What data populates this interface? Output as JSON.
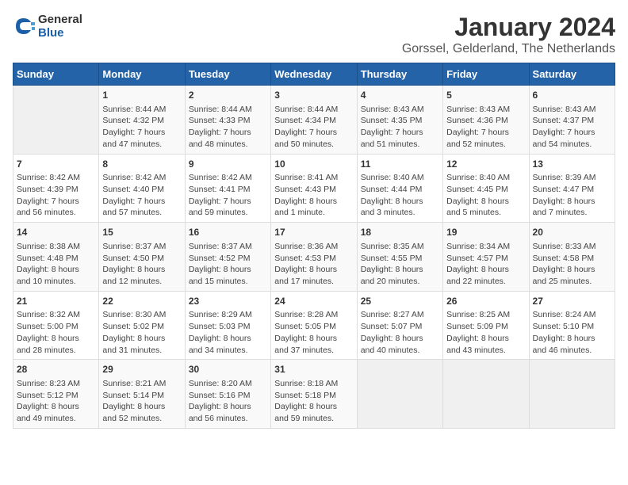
{
  "logo": {
    "text_general": "General",
    "text_blue": "Blue"
  },
  "title": "January 2024",
  "subtitle": "Gorssel, Gelderland, The Netherlands",
  "days_of_week": [
    "Sunday",
    "Monday",
    "Tuesday",
    "Wednesday",
    "Thursday",
    "Friday",
    "Saturday"
  ],
  "weeks": [
    [
      {
        "day": "",
        "content": ""
      },
      {
        "day": "1",
        "content": "Sunrise: 8:44 AM\nSunset: 4:32 PM\nDaylight: 7 hours\nand 47 minutes."
      },
      {
        "day": "2",
        "content": "Sunrise: 8:44 AM\nSunset: 4:33 PM\nDaylight: 7 hours\nand 48 minutes."
      },
      {
        "day": "3",
        "content": "Sunrise: 8:44 AM\nSunset: 4:34 PM\nDaylight: 7 hours\nand 50 minutes."
      },
      {
        "day": "4",
        "content": "Sunrise: 8:43 AM\nSunset: 4:35 PM\nDaylight: 7 hours\nand 51 minutes."
      },
      {
        "day": "5",
        "content": "Sunrise: 8:43 AM\nSunset: 4:36 PM\nDaylight: 7 hours\nand 52 minutes."
      },
      {
        "day": "6",
        "content": "Sunrise: 8:43 AM\nSunset: 4:37 PM\nDaylight: 7 hours\nand 54 minutes."
      }
    ],
    [
      {
        "day": "7",
        "content": "Sunrise: 8:42 AM\nSunset: 4:39 PM\nDaylight: 7 hours\nand 56 minutes."
      },
      {
        "day": "8",
        "content": "Sunrise: 8:42 AM\nSunset: 4:40 PM\nDaylight: 7 hours\nand 57 minutes."
      },
      {
        "day": "9",
        "content": "Sunrise: 8:42 AM\nSunset: 4:41 PM\nDaylight: 7 hours\nand 59 minutes."
      },
      {
        "day": "10",
        "content": "Sunrise: 8:41 AM\nSunset: 4:43 PM\nDaylight: 8 hours\nand 1 minute."
      },
      {
        "day": "11",
        "content": "Sunrise: 8:40 AM\nSunset: 4:44 PM\nDaylight: 8 hours\nand 3 minutes."
      },
      {
        "day": "12",
        "content": "Sunrise: 8:40 AM\nSunset: 4:45 PM\nDaylight: 8 hours\nand 5 minutes."
      },
      {
        "day": "13",
        "content": "Sunrise: 8:39 AM\nSunset: 4:47 PM\nDaylight: 8 hours\nand 7 minutes."
      }
    ],
    [
      {
        "day": "14",
        "content": "Sunrise: 8:38 AM\nSunset: 4:48 PM\nDaylight: 8 hours\nand 10 minutes."
      },
      {
        "day": "15",
        "content": "Sunrise: 8:37 AM\nSunset: 4:50 PM\nDaylight: 8 hours\nand 12 minutes."
      },
      {
        "day": "16",
        "content": "Sunrise: 8:37 AM\nSunset: 4:52 PM\nDaylight: 8 hours\nand 15 minutes."
      },
      {
        "day": "17",
        "content": "Sunrise: 8:36 AM\nSunset: 4:53 PM\nDaylight: 8 hours\nand 17 minutes."
      },
      {
        "day": "18",
        "content": "Sunrise: 8:35 AM\nSunset: 4:55 PM\nDaylight: 8 hours\nand 20 minutes."
      },
      {
        "day": "19",
        "content": "Sunrise: 8:34 AM\nSunset: 4:57 PM\nDaylight: 8 hours\nand 22 minutes."
      },
      {
        "day": "20",
        "content": "Sunrise: 8:33 AM\nSunset: 4:58 PM\nDaylight: 8 hours\nand 25 minutes."
      }
    ],
    [
      {
        "day": "21",
        "content": "Sunrise: 8:32 AM\nSunset: 5:00 PM\nDaylight: 8 hours\nand 28 minutes."
      },
      {
        "day": "22",
        "content": "Sunrise: 8:30 AM\nSunset: 5:02 PM\nDaylight: 8 hours\nand 31 minutes."
      },
      {
        "day": "23",
        "content": "Sunrise: 8:29 AM\nSunset: 5:03 PM\nDaylight: 8 hours\nand 34 minutes."
      },
      {
        "day": "24",
        "content": "Sunrise: 8:28 AM\nSunset: 5:05 PM\nDaylight: 8 hours\nand 37 minutes."
      },
      {
        "day": "25",
        "content": "Sunrise: 8:27 AM\nSunset: 5:07 PM\nDaylight: 8 hours\nand 40 minutes."
      },
      {
        "day": "26",
        "content": "Sunrise: 8:25 AM\nSunset: 5:09 PM\nDaylight: 8 hours\nand 43 minutes."
      },
      {
        "day": "27",
        "content": "Sunrise: 8:24 AM\nSunset: 5:10 PM\nDaylight: 8 hours\nand 46 minutes."
      }
    ],
    [
      {
        "day": "28",
        "content": "Sunrise: 8:23 AM\nSunset: 5:12 PM\nDaylight: 8 hours\nand 49 minutes."
      },
      {
        "day": "29",
        "content": "Sunrise: 8:21 AM\nSunset: 5:14 PM\nDaylight: 8 hours\nand 52 minutes."
      },
      {
        "day": "30",
        "content": "Sunrise: 8:20 AM\nSunset: 5:16 PM\nDaylight: 8 hours\nand 56 minutes."
      },
      {
        "day": "31",
        "content": "Sunrise: 8:18 AM\nSunset: 5:18 PM\nDaylight: 8 hours\nand 59 minutes."
      },
      {
        "day": "",
        "content": ""
      },
      {
        "day": "",
        "content": ""
      },
      {
        "day": "",
        "content": ""
      }
    ]
  ]
}
